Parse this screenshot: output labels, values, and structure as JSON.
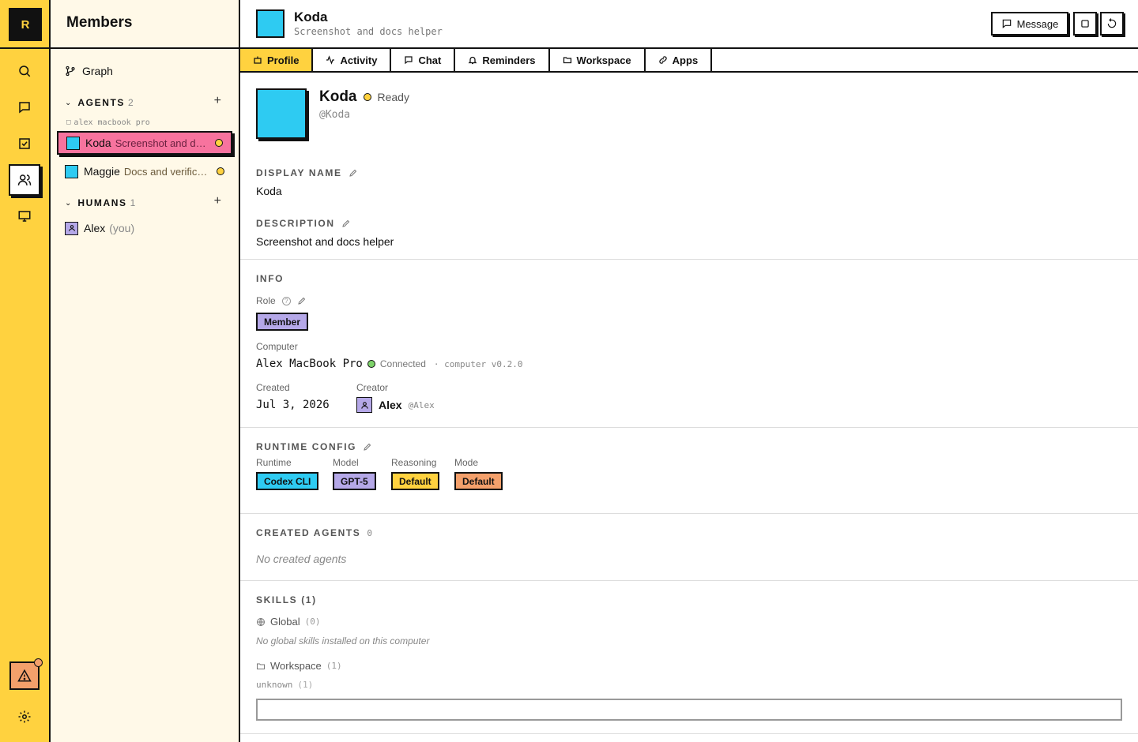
{
  "logo": "R",
  "sidebar": {
    "title": "Members",
    "graph_label": "Graph",
    "agents": {
      "label": "AGENTS",
      "count": "2",
      "machine": "alex macbook pro",
      "items": [
        {
          "name": "Koda",
          "description": "Screenshot and docs helper",
          "color": "#2ecbf2"
        },
        {
          "name": "Maggie",
          "description": "Docs and verification",
          "color": "#2ecbf2"
        }
      ]
    },
    "humans": {
      "label": "HUMANS",
      "count": "1",
      "items": [
        {
          "name": "Alex",
          "suffix": "(you)",
          "color": "#b5a8e8"
        }
      ]
    }
  },
  "header": {
    "name": "Koda",
    "subtitle": "Screenshot and docs helper",
    "message_label": "Message"
  },
  "tabs": [
    "Profile",
    "Activity",
    "Chat",
    "Reminders",
    "Workspace",
    "Apps"
  ],
  "profile": {
    "name": "Koda",
    "status": "Ready",
    "handle": "@Koda",
    "display_name_label": "DISPLAY NAME",
    "display_name": "Koda",
    "description_label": "DESCRIPTION",
    "description": "Screenshot and docs helper"
  },
  "info": {
    "label": "INFO",
    "role_label": "Role",
    "role": "Member",
    "computer_label": "Computer",
    "computer": "Alex MacBook Pro",
    "connection": "Connected",
    "computer_version": "· computer v0.2.0",
    "created_label": "Created",
    "created": "Jul 3, 2026",
    "creator_label": "Creator",
    "creator": "Alex",
    "creator_handle": "@Alex"
  },
  "runtime": {
    "label": "RUNTIME CONFIG",
    "items": [
      {
        "label": "Runtime",
        "value": "Codex CLI",
        "color": "#2ecbf2"
      },
      {
        "label": "Model",
        "value": "GPT-5",
        "color": "#b5a8e8"
      },
      {
        "label": "Reasoning",
        "value": "Default",
        "color": "#ffd23f"
      },
      {
        "label": "Mode",
        "value": "Default",
        "color": "#f4a06b"
      }
    ]
  },
  "created_agents": {
    "label": "CREATED AGENTS",
    "count": "0",
    "empty": "No created agents"
  },
  "skills": {
    "label": "SKILLS (1)",
    "global_label": "Global",
    "global_count": "(0)",
    "global_empty": "No global skills installed on this computer",
    "workspace_label": "Workspace",
    "workspace_count": "(1)",
    "unknown_label": "unknown",
    "unknown_count": "(1)"
  }
}
